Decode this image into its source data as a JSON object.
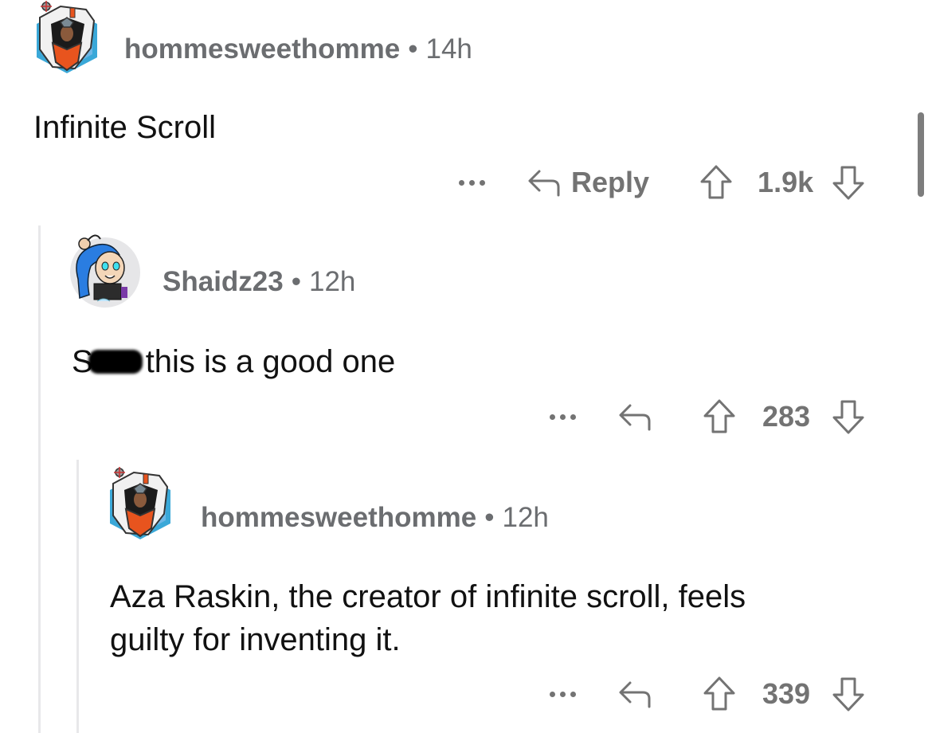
{
  "comments": [
    {
      "username": "hommesweethomme",
      "separator": "•",
      "age": "14h",
      "avatar": "robot-helmet-avatar",
      "body": "Infinite Scroll",
      "reply_label": "Reply",
      "vote_count": "1.9k"
    },
    {
      "username": "Shaidz23",
      "separator": "•",
      "age": "12h",
      "avatar": "blue-hair-girl-avatar",
      "body_prefix": "S",
      "body_redacted": true,
      "body": "this is a good one",
      "vote_count": "283"
    },
    {
      "username": "hommesweethomme",
      "separator": "•",
      "age": "12h",
      "avatar": "robot-helmet-avatar",
      "body_line1": "Aza Raskin, the creator of infinite scroll, feels",
      "body_line2": "guilty for inventing it.",
      "vote_count": "339"
    }
  ],
  "colors": {
    "meta_text": "#6b6d70",
    "body_text": "#111111",
    "action_gray": "#737373",
    "thread_line": "#e8e8ea"
  }
}
